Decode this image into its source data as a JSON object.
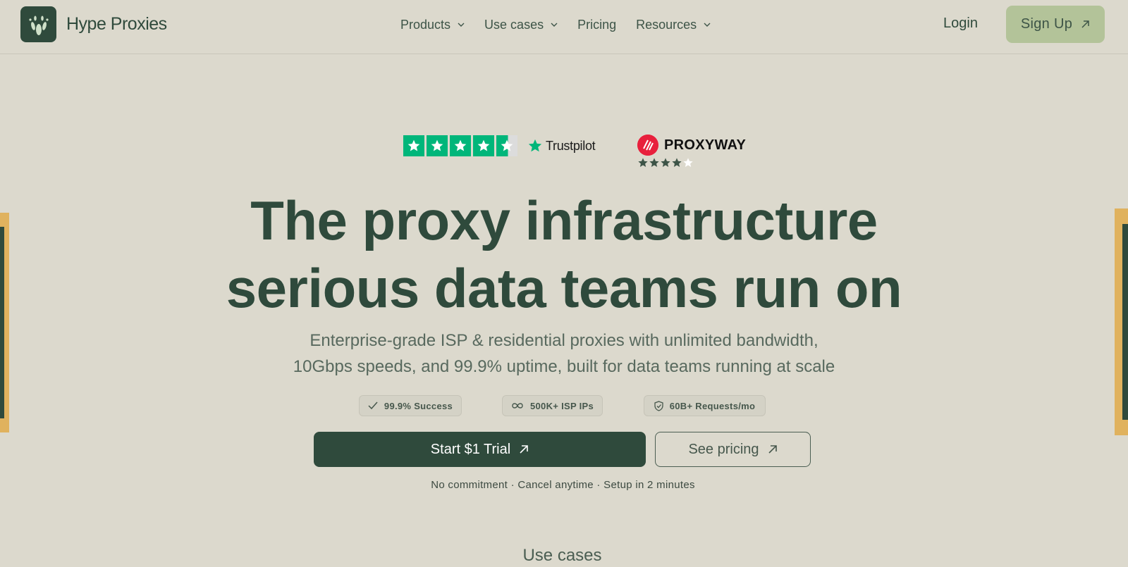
{
  "brand": {
    "name": "Hype Proxies"
  },
  "nav": {
    "items": [
      {
        "label": "Products",
        "dropdown": true
      },
      {
        "label": "Use cases",
        "dropdown": true
      },
      {
        "label": "Pricing",
        "dropdown": false
      },
      {
        "label": "Resources",
        "dropdown": true
      }
    ],
    "login": "Login",
    "signup": "Sign Up"
  },
  "ratings": {
    "trustpilot": {
      "label": "Trustpilot",
      "stars": 4.5
    },
    "proxyway": {
      "label": "PROXYWAY",
      "stars": 4
    }
  },
  "hero": {
    "headline_line1": "The proxy infrastructure",
    "headline_line2": "serious data teams run on",
    "sub_line1": "Enterprise-grade ISP & residential proxies with unlimited bandwidth,",
    "sub_line2": "10Gbps speeds, and 99.9% uptime, built for data teams running at scale",
    "badges": [
      {
        "icon": "check-icon",
        "label": "99.9% Success"
      },
      {
        "icon": "infinity-icon",
        "label": "500K+ ISP IPs"
      },
      {
        "icon": "shield-icon",
        "label": "60B+ Requests/mo"
      }
    ],
    "primary_cta": "Start $1 Trial",
    "secondary_cta": "See pricing",
    "note": "No commitment · Cancel anytime · Setup in 2 minutes"
  },
  "next_section": {
    "title": "Use cases"
  },
  "colors": {
    "background": "#dcd9cd",
    "primary": "#2f4a3c",
    "accent": "#b3c399",
    "trustpilot": "#00b67a",
    "proxyway": "#e8203c"
  }
}
